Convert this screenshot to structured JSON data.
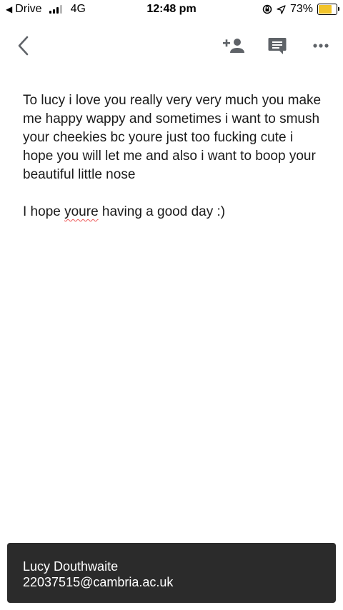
{
  "status_bar": {
    "back_app": "Drive",
    "network": "4G",
    "time": "12:48 pm",
    "battery_percent": "73%",
    "battery_level": 0.73,
    "signal_bars": 3,
    "icons": [
      "orientation-lock-icon",
      "location-arrow-icon"
    ]
  },
  "toolbar": {
    "back": "back-chevron-icon",
    "add_person": "add-person-icon",
    "comment": "comment-icon",
    "more": "more-dots-icon"
  },
  "document": {
    "paragraph1": "To lucy i love you really very very much you make me happy wappy and sometimes i want to smush your cheekies bc youre just too fucking cute i hope you will let me and also i want to boop your beautiful little nose",
    "paragraph2_before": "I hope ",
    "paragraph2_misspelled": "youre",
    "paragraph2_after": " having a  good day :)"
  },
  "toast": {
    "name": "Lucy Douthwaite",
    "email": "22037515@cambria.ac.uk"
  },
  "colors": {
    "battery_fill": "#f2c42b",
    "toast_bg": "#2b2b2b",
    "icon_gray": "#5f6368",
    "spell_underline": "#e55555"
  }
}
